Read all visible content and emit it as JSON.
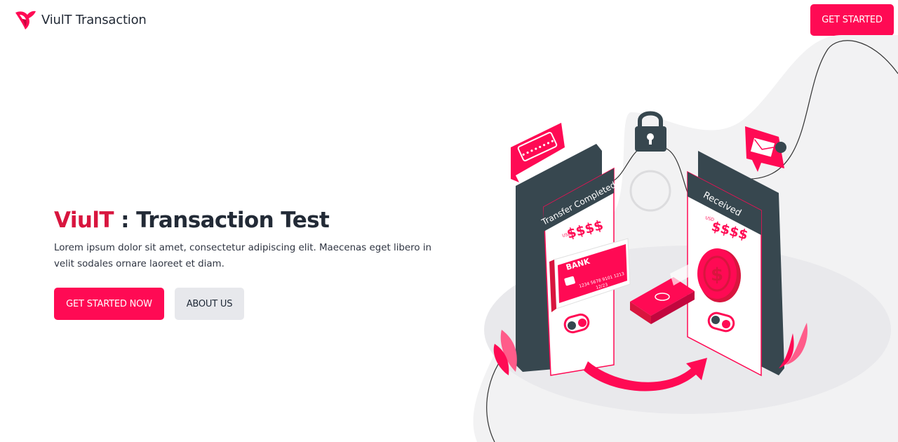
{
  "nav": {
    "brand_name": "ViulT Transaction",
    "cta_label": "GET STARTED"
  },
  "hero": {
    "title_accent": "ViulT",
    "title_rest": " : Transaction Test",
    "description": "Lorem ipsum dolor sit amet, consectetur adipiscing elit. Maecenas eget libero in velit sodales ornare laoreet et diam.",
    "primary_button": "GET STARTED NOW",
    "secondary_button": "ABOUT US"
  },
  "illustration": {
    "left_phone_header": "Transfer Completed",
    "left_currency": "USD",
    "left_amount": "$$$$",
    "right_phone_header": "Received",
    "right_currency": "USD",
    "right_amount": "$$$$",
    "card_label": "BANK",
    "card_number": "1234 5678 9101 1213",
    "card_expiry": "12/23",
    "password_mask": "••••••••"
  },
  "colors": {
    "accent": "#ff0a54",
    "accent_dark": "#d8153e",
    "text_dark": "#222a36",
    "phone_body": "#37474f",
    "blob": "#f2f2f3"
  },
  "icons": [
    "logo-icon",
    "lock-icon",
    "envelope-bell-icon",
    "dollar-coin-icon",
    "bank-card-icon",
    "user-toggle-icon",
    "curved-arrow-icon",
    "cash-stack-icon",
    "leaf-icon"
  ]
}
